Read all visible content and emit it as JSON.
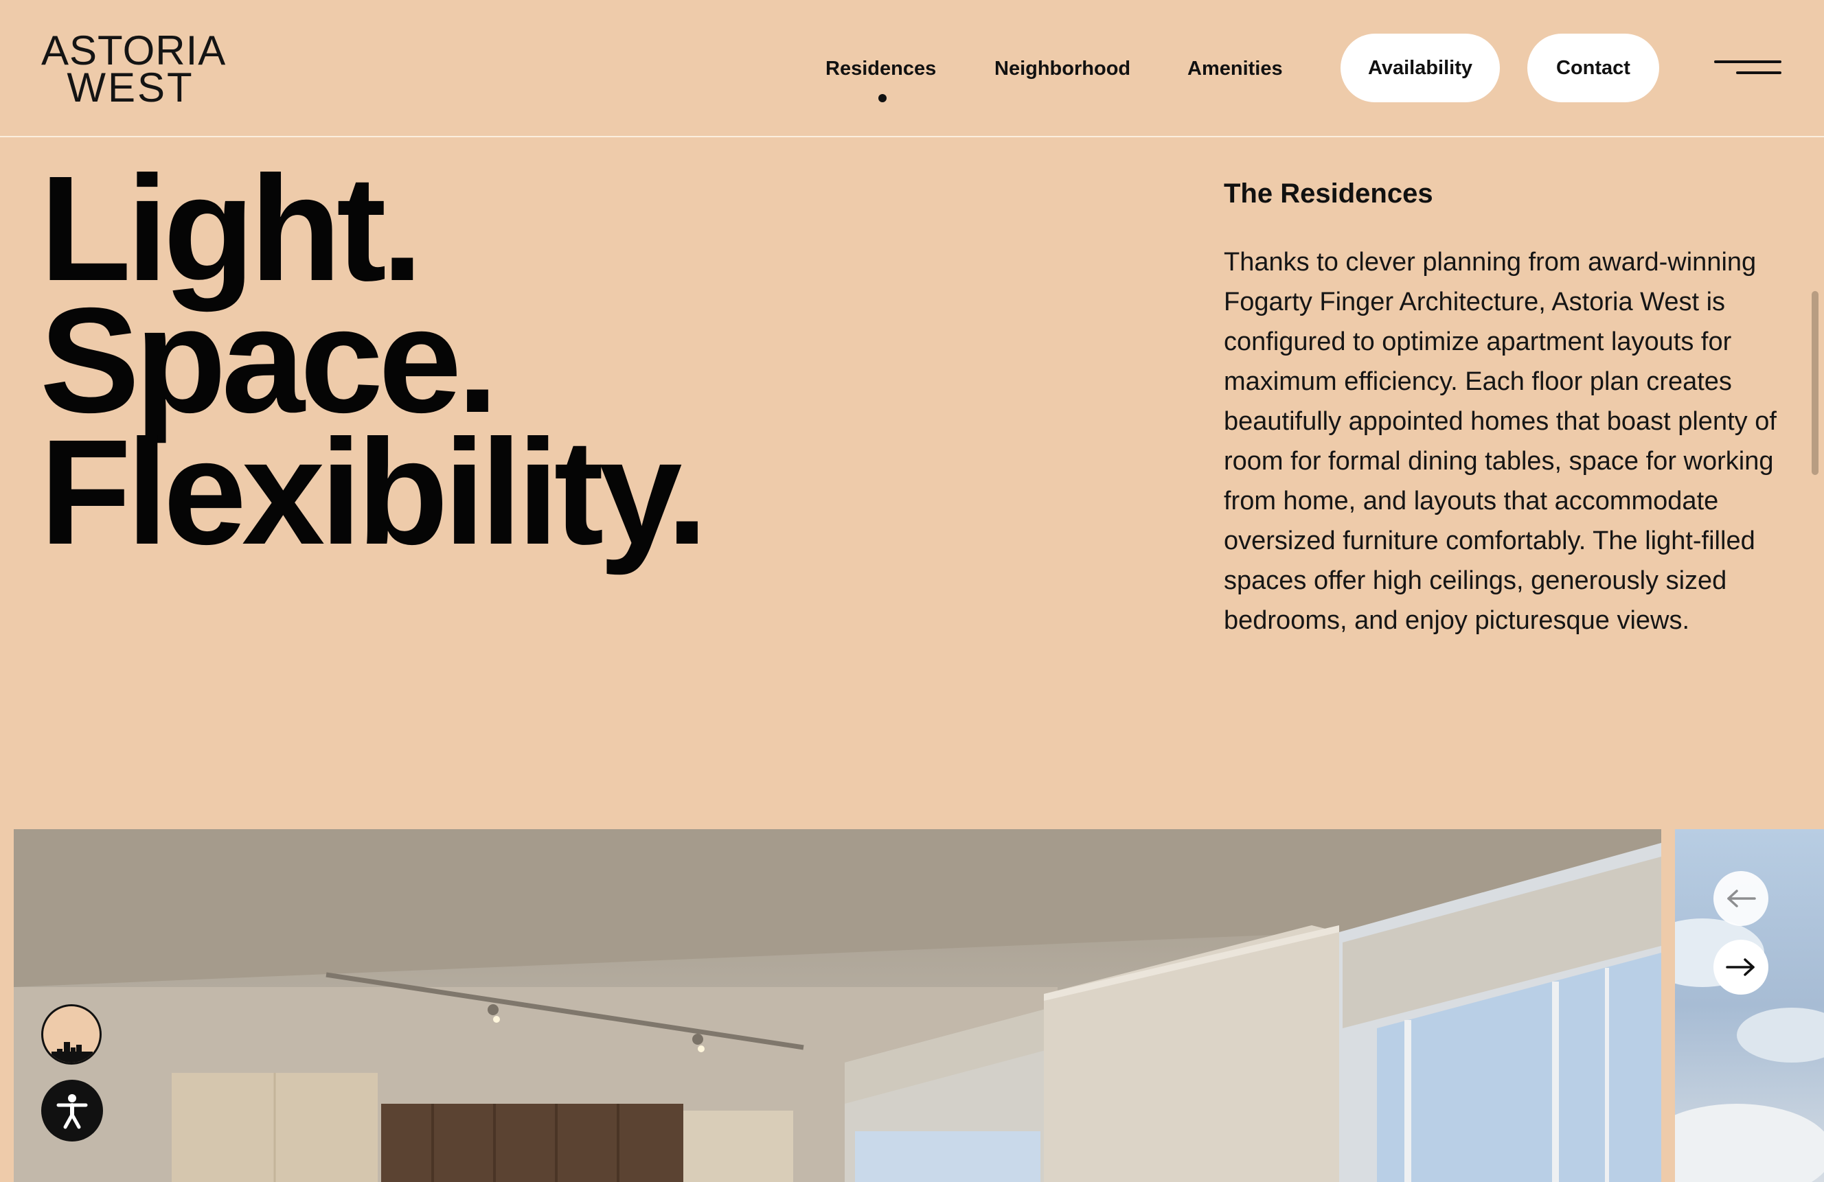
{
  "brand": {
    "logo_line1": "ASTORIA",
    "logo_line2": "WEST"
  },
  "nav": {
    "items": [
      {
        "label": "Residences",
        "active": true
      },
      {
        "label": "Neighborhood",
        "active": false
      },
      {
        "label": "Amenities",
        "active": false
      }
    ],
    "availability_label": "Availability",
    "contact_label": "Contact",
    "menu_icon": "hamburger-menu-icon"
  },
  "hero": {
    "headline": [
      "Light.",
      "Space.",
      "Flexibility."
    ],
    "section_title": "The Residences",
    "body": "Thanks to clever planning from award-winning Fogarty Finger Architecture, Astoria West is configured to optimize apartment layouts for maximum efficiency. Each floor plan creates beautifully appointed homes that boast plenty of room for formal dining tables, space for working from home, and layouts that accommodate oversized furniture comfortably. The light-filled spaces offer high ceilings, generously sized bedrooms, and enjoy picturesque views."
  },
  "gallery": {
    "prev_icon": "arrow-left-icon",
    "next_icon": "arrow-right-icon"
  },
  "widgets": {
    "skyline_icon": "skyline-icon",
    "accessibility_icon": "accessibility-icon"
  },
  "colors": {
    "background": "#eecbaa",
    "text": "#0d0d0d",
    "button_bg": "#ffffff"
  }
}
